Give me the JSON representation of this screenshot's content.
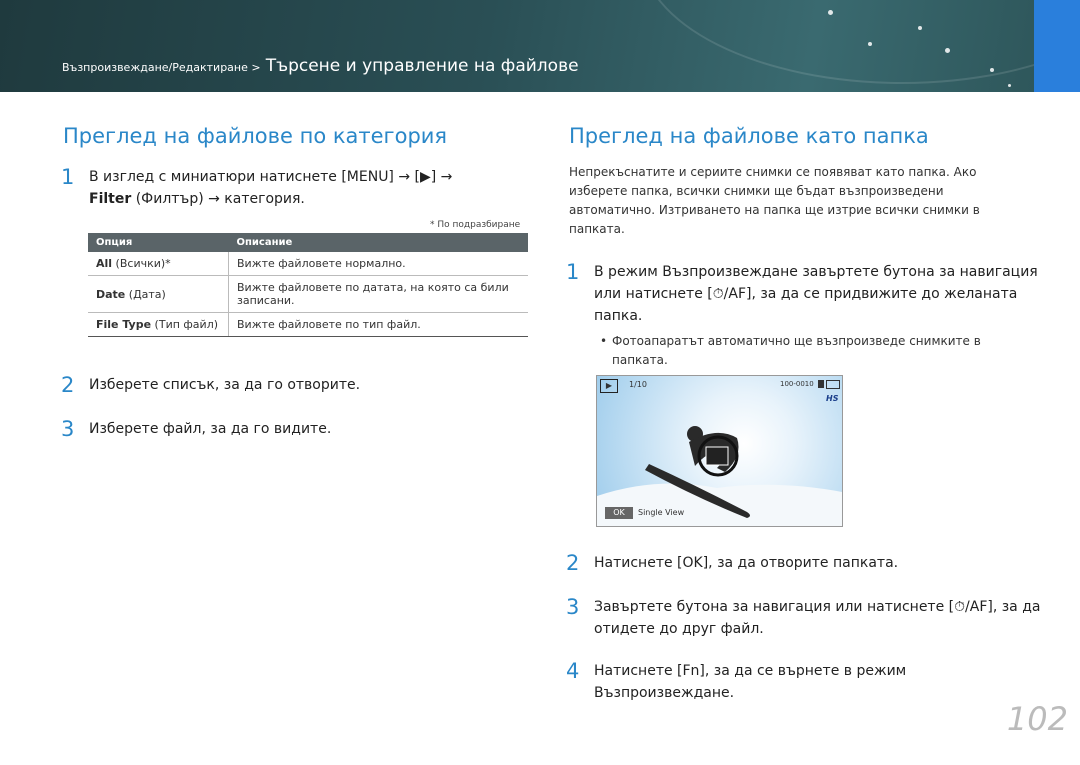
{
  "header": {
    "breadcrumb_section": "Възпроизвеждане/Редактиране >",
    "breadcrumb_page": "Търсене и управление на файлове"
  },
  "left": {
    "title": "Преглед на файлове по категория",
    "step1_num": "1",
    "step1_line1": "В изглед с миниатюри натиснете [MENU] → [▶] →",
    "step1_filter": "Filter",
    "step1_rest": " (Филтър) → категория.",
    "default_note": "* По подразбиране",
    "table": {
      "headers": [
        "Опция",
        "Описание"
      ],
      "rows": [
        {
          "opt_bold": "All",
          "opt_rest": " (Всички)*",
          "desc": "Вижте файловете нормално."
        },
        {
          "opt_bold": "Date",
          "opt_rest": " (Дата)",
          "desc": "Вижте файловете по датата, на която са били записани."
        },
        {
          "opt_bold": "File Type",
          "opt_rest": " (Тип файл)",
          "desc": "Вижте файловете по тип файл."
        }
      ]
    },
    "step2_num": "2",
    "step2": "Изберете списък, за да го отворите.",
    "step3_num": "3",
    "step3": "Изберете файл, за да го видите."
  },
  "right": {
    "title": "Преглед на файлове като папка",
    "intro": "Непрекъснатите и сериите снимки се появяват като папка. Ако изберете папка, всички снимки ще бъдат възпроизведени автоматично. Изтриването на папка ще изтрие всички снимки в папката.",
    "step1_num": "1",
    "step1": "В режим Възпроизвеждане завъртете бутона за навигация или натиснете [⏱/AF], за да се придвижите до желаната папка.",
    "bullet": "Фотоапаратът автоматично ще възпроизведе снимките в папката.",
    "step2_num": "2",
    "step2": "Натиснете [OK], за да отворите папката.",
    "step3_num": "3",
    "step3": "Завъртете бутона за навигация или натиснете [⏱/AF], за да отидете до друг файл.",
    "step4_num": "4",
    "step4": "Натиснете [Fn], за да се върнете в режим Възпроизвеждане."
  },
  "camera": {
    "counter": "1/10",
    "file_no": "100-0010",
    "hs": "HS",
    "ok": "OK",
    "single_view": "Single View"
  },
  "page_number": "102"
}
